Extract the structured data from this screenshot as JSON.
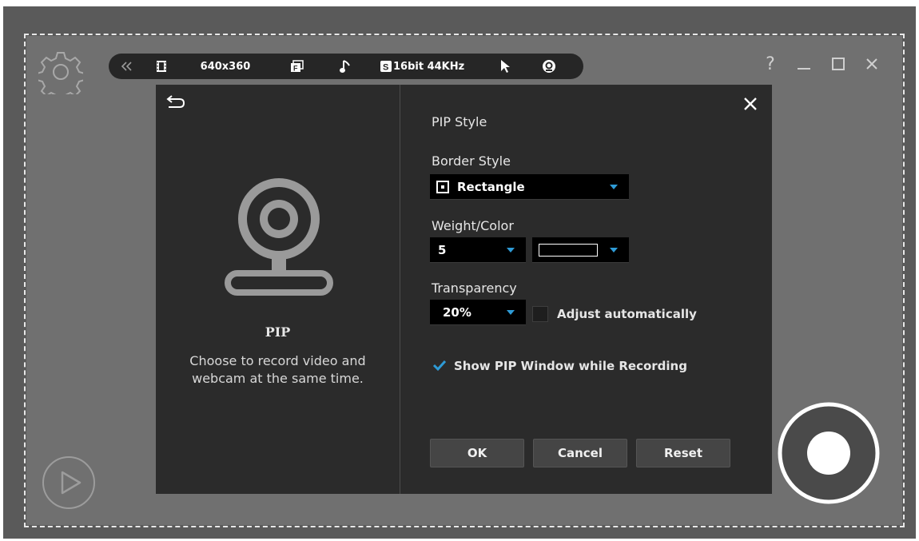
{
  "toolbar": {
    "resolution": "640x360",
    "audio": "16bit 44KHz",
    "icons": [
      "collapse-icon",
      "film-icon",
      "fps-icon",
      "music-note-icon",
      "audio-s-icon",
      "cursor-icon",
      "webcam-badge-icon"
    ]
  },
  "window": {
    "help": "?"
  },
  "left_panel": {
    "title": "PIP",
    "description_line1": "Choose to record video and",
    "description_line2": "webcam at the same time."
  },
  "pip_style": {
    "heading": "PIP Style",
    "border_style_label": "Border Style",
    "border_style_value": "Rectangle",
    "weight_color_label": "Weight/Color",
    "weight_value": "5",
    "color_value": "#000000",
    "transparency_label": "Transparency",
    "transparency_value": "20%",
    "adjust_label": "Adjust automatically",
    "adjust_checked": false,
    "show_pip_label": "Show PIP Window while Recording",
    "show_pip_checked": true
  },
  "buttons": {
    "ok": "OK",
    "cancel": "Cancel",
    "reset": "Reset"
  },
  "colors": {
    "accent": "#2e9bd6",
    "dialog_bg": "#2b2b2b",
    "outer_bg": "#707070"
  }
}
